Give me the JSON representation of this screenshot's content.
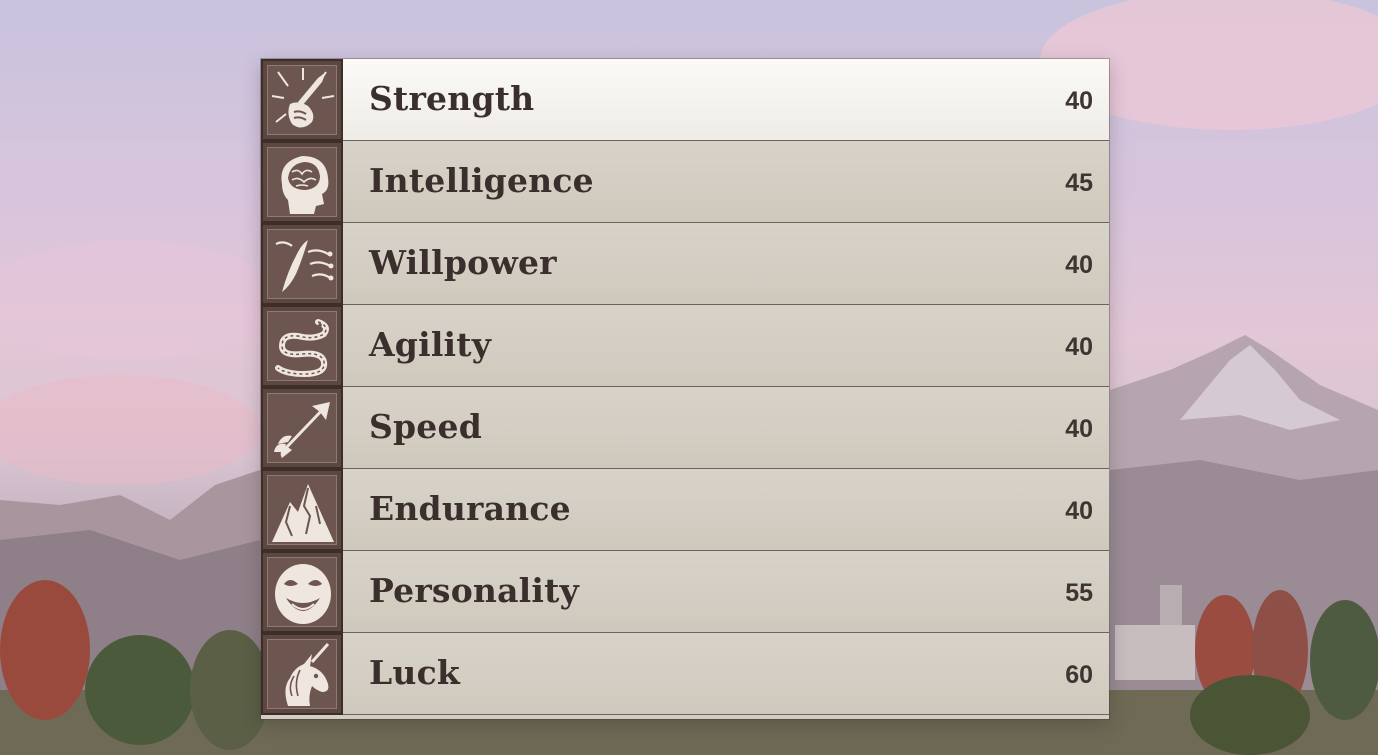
{
  "attributes": [
    {
      "name": "Strength",
      "value": "40",
      "icon": "sword-fist-icon",
      "selected": true
    },
    {
      "name": "Intelligence",
      "value": "45",
      "icon": "brain-head-icon",
      "selected": false
    },
    {
      "name": "Willpower",
      "value": "40",
      "icon": "wind-feather-icon",
      "selected": false
    },
    {
      "name": "Agility",
      "value": "40",
      "icon": "serpent-icon",
      "selected": false
    },
    {
      "name": "Speed",
      "value": "40",
      "icon": "arrow-icon",
      "selected": false
    },
    {
      "name": "Endurance",
      "value": "40",
      "icon": "mountain-icon",
      "selected": false
    },
    {
      "name": "Personality",
      "value": "55",
      "icon": "smiling-mask-icon",
      "selected": false
    },
    {
      "name": "Luck",
      "value": "60",
      "icon": "unicorn-icon",
      "selected": false
    }
  ],
  "colors": {
    "parchment": "#d3cec3",
    "selected_row": "#f6f4f0",
    "icon_frame": "#5b4640",
    "text": "#3a2f2c"
  }
}
